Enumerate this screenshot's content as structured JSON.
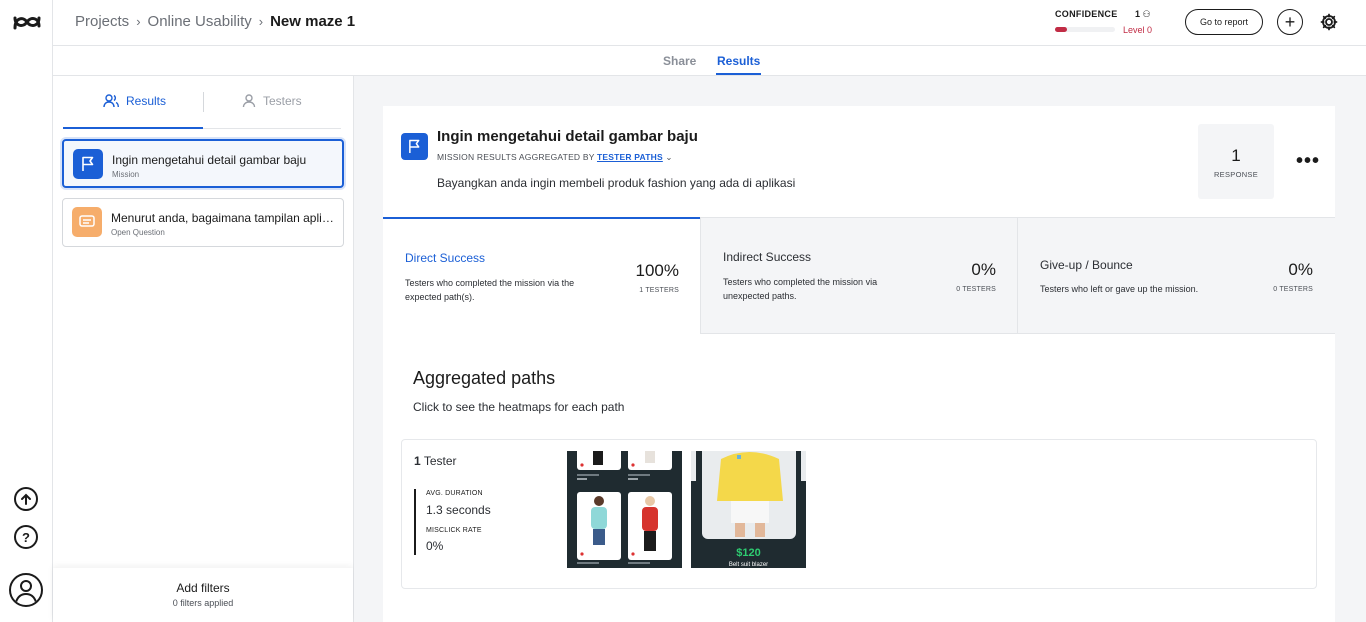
{
  "breadcrumb": {
    "items": [
      "Projects",
      "Online Usability"
    ],
    "current": "New maze 1"
  },
  "header": {
    "confidence_label": "CONFIDENCE",
    "confidence_count": "1",
    "confidence_level": "Level 0",
    "confidence_fraction": 0.2,
    "go_to_report": "Go to report"
  },
  "tabs": {
    "share": "Share",
    "results": "Results"
  },
  "sidebar": {
    "tab_results": "Results",
    "tab_testers": "Testers",
    "blocks": [
      {
        "title": "Ingin mengetahui detail gambar baju",
        "type": "Mission",
        "color": "#1b5fd6"
      },
      {
        "title": "Menurut anda, bagaimana tampilan aplikasi",
        "type": "Open Question",
        "color": "#f6ad6b"
      }
    ],
    "filters_title": "Add filters",
    "filters_sub": "0 filters applied"
  },
  "mission": {
    "title": "Ingin mengetahui detail gambar baju",
    "agg_prefix": "MISSION RESULTS AGGREGATED BY",
    "agg_link": "TESTER PATHS",
    "description": "Bayangkan anda ingin membeli produk fashion yang ada di aplikasi",
    "responses": "1",
    "responses_label": "RESPONSE"
  },
  "stats": [
    {
      "title": "Direct Success",
      "desc": "Testers who completed the mission via the expected path(s).",
      "pct": "100%",
      "count": "1 TESTERS"
    },
    {
      "title": "Indirect Success",
      "desc": "Testers who completed the mission via unexpected paths.",
      "pct": "0%",
      "count": "0 TESTERS"
    },
    {
      "title": "Give-up / Bounce",
      "desc": "Testers who left or gave up the mission.",
      "pct": "0%",
      "count": "0 TESTERS"
    }
  ],
  "aggregated": {
    "title": "Aggregated paths",
    "subtitle": "Click to see the heatmaps for each path",
    "path": {
      "tester_count": "1",
      "tester_word": "Tester",
      "avg_label": "AVG. DURATION",
      "avg_value": "1.3 seconds",
      "misclick_label": "MISCLICK RATE",
      "misclick_value": "0%",
      "price": "$120",
      "product_name": "Belt suit blazer",
      "small_price": "$120"
    }
  },
  "colors": {
    "accent": "#1b5fd6",
    "danger": "#c12c45",
    "price": "#2ecc71"
  }
}
